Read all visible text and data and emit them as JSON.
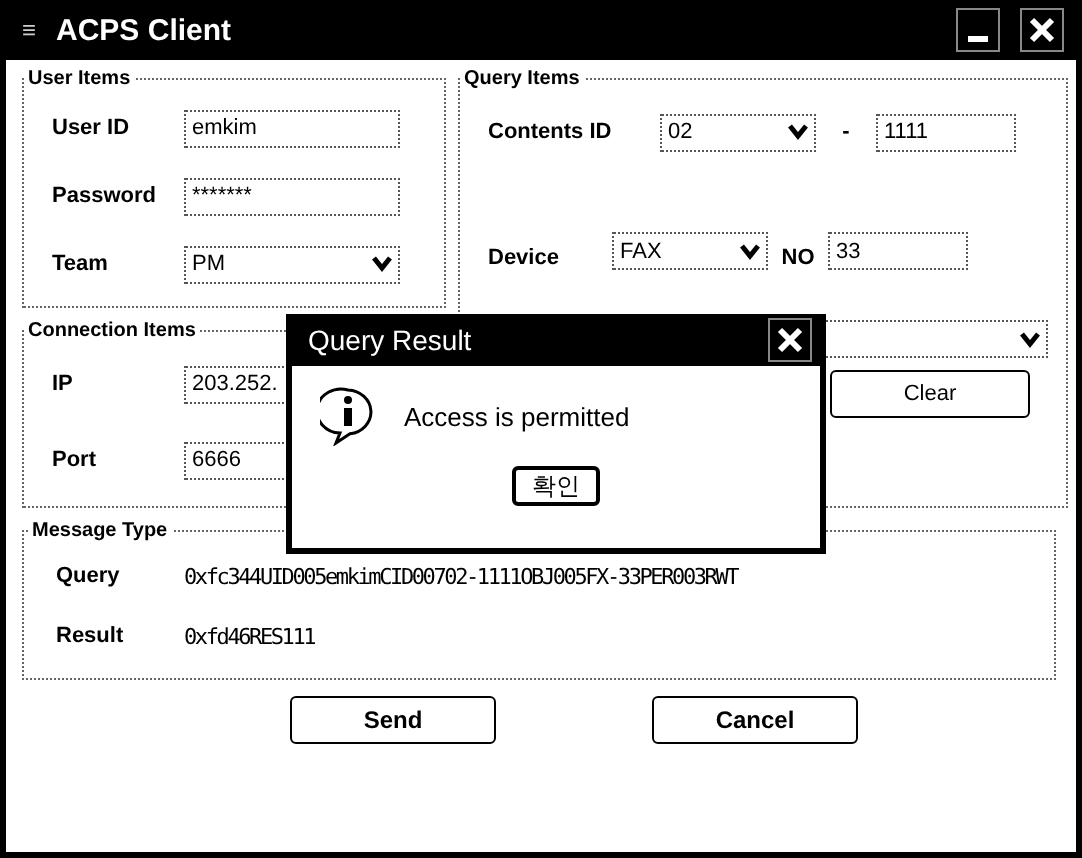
{
  "window": {
    "title": "ACPS Client",
    "menu_glyph": "≡"
  },
  "user_items": {
    "title": "User Items",
    "fields": [
      {
        "label": "User ID",
        "value": "emkim",
        "kind": "text"
      },
      {
        "label": "Password",
        "value": "*******",
        "kind": "text"
      },
      {
        "label": "Team",
        "value": "PM",
        "kind": "select"
      }
    ]
  },
  "connection_items": {
    "title": "Connection Items",
    "fields": [
      {
        "label": "IP",
        "value": "203.252.",
        "kind": "text"
      },
      {
        "label": "Port",
        "value": "6666",
        "kind": "text"
      }
    ]
  },
  "query_items": {
    "title": "Query Items",
    "rows": [
      {
        "label": "Contents ID",
        "first": {
          "value": "02",
          "kind": "select"
        },
        "separator": "-",
        "second": {
          "value": "1111",
          "kind": "text"
        }
      },
      {
        "label": "Device",
        "first": {
          "value": "FAX",
          "kind": "select"
        },
        "separator": "NO",
        "second": {
          "value": "33",
          "kind": "text"
        }
      }
    ],
    "clear_button": "Clear"
  },
  "message_type": {
    "title": "Message Type",
    "rows": [
      {
        "label": "Query",
        "value": "0xfc344UID005emkimCID00702-1111OBJ005FX-33PER003RWT"
      },
      {
        "label": "Result",
        "value": "0xfd46RES111"
      }
    ]
  },
  "buttons": [
    "Send",
    "Cancel"
  ],
  "dialog": {
    "title": "Query Result",
    "message": "Access is permitted",
    "button": "확인"
  }
}
